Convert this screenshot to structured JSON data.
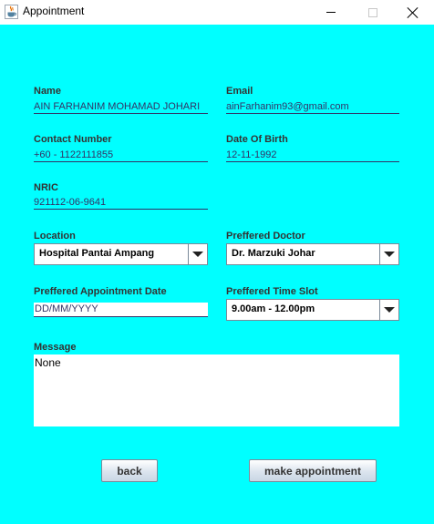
{
  "window": {
    "title": "Appointment",
    "icon": "java-cup-icon"
  },
  "form": {
    "name": {
      "label": "Name",
      "value": "AIN FARHANIM MOHAMAD JOHARI"
    },
    "email": {
      "label": "Email",
      "value": "ainFarhanim93@gmail.com"
    },
    "contact": {
      "label": "Contact Number",
      "value": "+60 - 1122111855"
    },
    "dob": {
      "label": "Date Of Birth",
      "value": "12-11-1992"
    },
    "nric": {
      "label": "NRIC",
      "value": "921112-06-9641"
    },
    "location": {
      "label": "Location",
      "selected": "Hospital Pantai Ampang"
    },
    "doctor": {
      "label": "Preffered Doctor",
      "selected": "Dr. Marzuki Johar"
    },
    "appt_date": {
      "label": "Preffered Appointment Date",
      "value": "DD/MM/YYYY"
    },
    "time_slot": {
      "label": "Preffered Time Slot",
      "selected": "9.00am - 12.00pm"
    },
    "message": {
      "label": "Message",
      "value": "None"
    }
  },
  "buttons": {
    "back": "back",
    "make_appointment": "make appointment"
  },
  "colors": {
    "panel_background": "#00ffff",
    "window_background": "#ffffff"
  }
}
